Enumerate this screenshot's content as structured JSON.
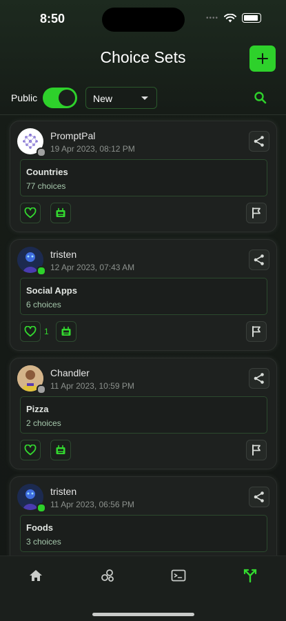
{
  "status_bar": {
    "time": "8:50"
  },
  "header": {
    "title": "Choice Sets",
    "add_icon": "plus-icon"
  },
  "filters": {
    "public_label": "Public",
    "public_toggle_on": true,
    "sort_value": "New",
    "search_icon": "search-icon"
  },
  "cards": [
    {
      "username": "PromptPal",
      "timestamp": "19 Apr 2023, 08:12 PM",
      "set_name": "Countries",
      "choice_count": "77 choices",
      "like_count": "",
      "online": false
    },
    {
      "username": "tristen",
      "timestamp": "12 Apr 2023, 07:43 AM",
      "set_name": "Social Apps",
      "choice_count": "6 choices",
      "like_count": "1",
      "online": true
    },
    {
      "username": "Chandler",
      "timestamp": "11 Apr 2023, 10:59 PM",
      "set_name": "Pizza",
      "choice_count": "2 choices",
      "like_count": "",
      "online": false
    },
    {
      "username": "tristen",
      "timestamp": "11 Apr 2023, 06:56 PM",
      "set_name": "Foods",
      "choice_count": "3 choices",
      "like_count": "",
      "online": true
    }
  ],
  "tabs": [
    {
      "icon": "home-icon",
      "active": false
    },
    {
      "icon": "circles-icon",
      "active": false
    },
    {
      "icon": "terminal-icon",
      "active": false
    },
    {
      "icon": "branch-arrows-icon",
      "active": true
    }
  ],
  "colors": {
    "accent": "#2ed12b",
    "background": "#161c17",
    "card": "#1e211f",
    "online": "#2ed12b",
    "offline": "#a0a0a0"
  }
}
